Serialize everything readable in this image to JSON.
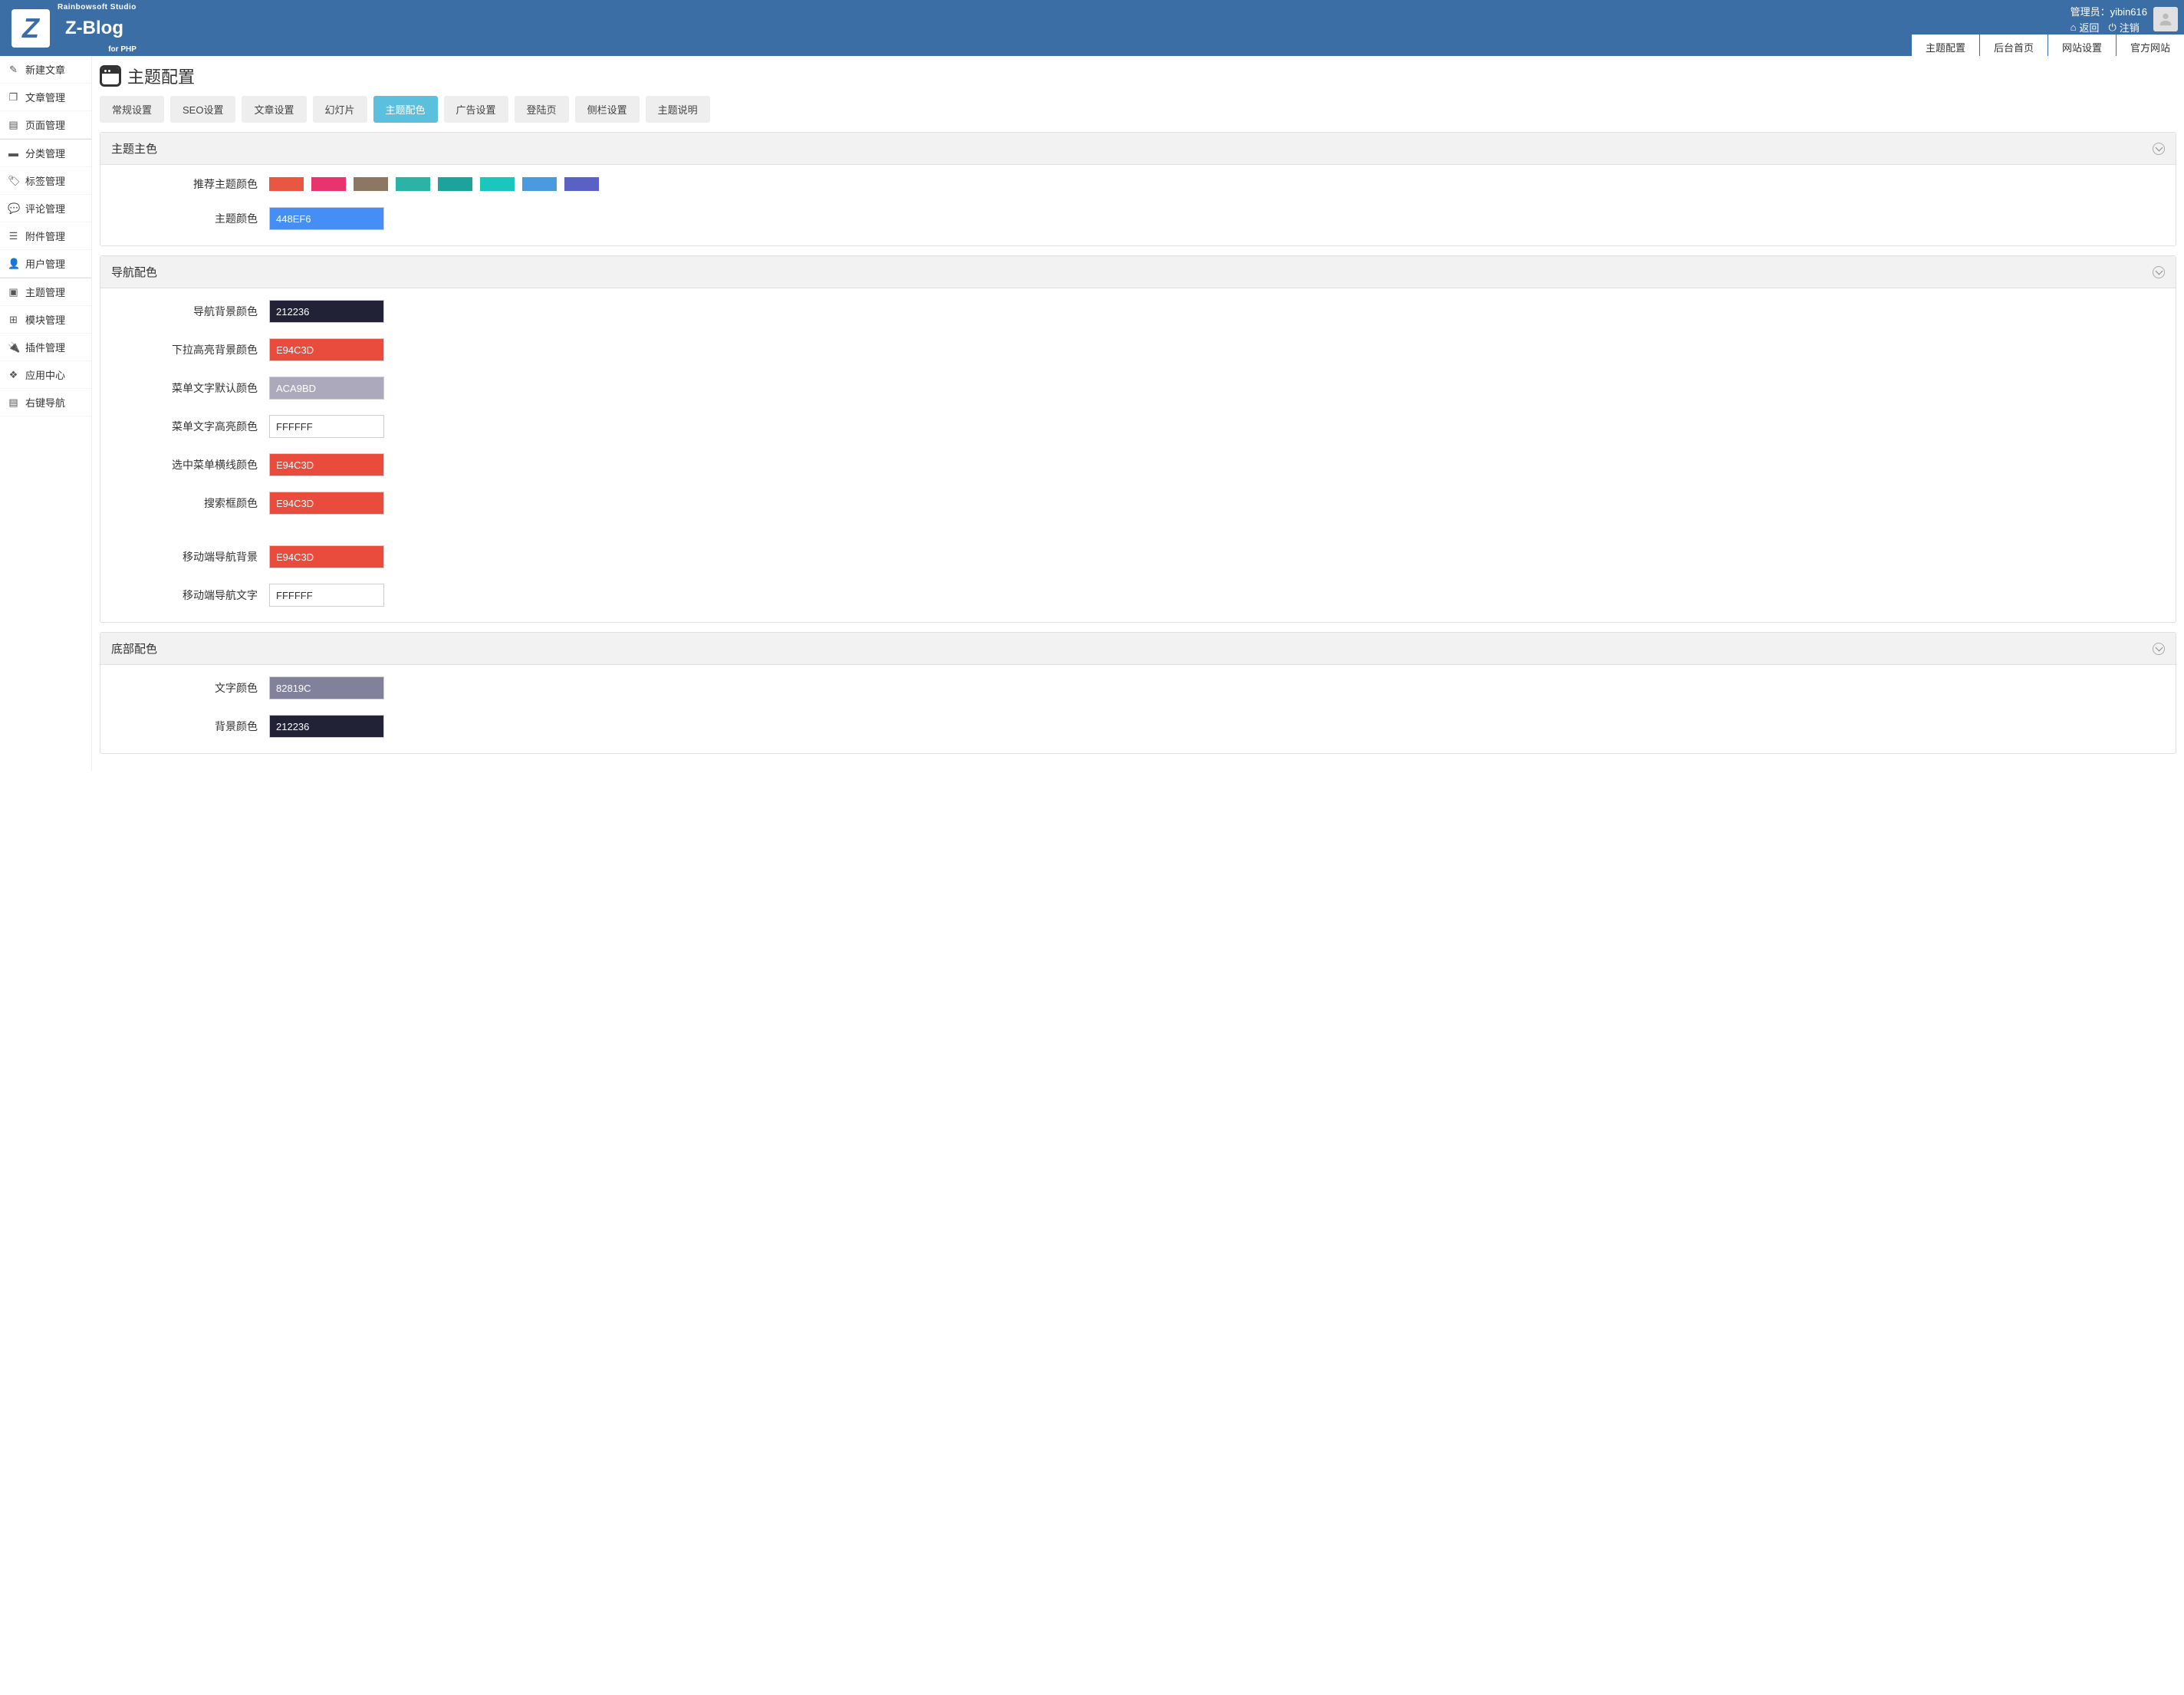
{
  "header": {
    "logo_sub": "Rainbowsoft Studio",
    "logo_main": "Z-Blog",
    "logo_php": "for PHP",
    "admin_label": "管理员：yibin616",
    "back_link": "返回",
    "logout_link": "注销",
    "top_tabs": [
      "主题配置",
      "后台首页",
      "网站设置",
      "官方网站"
    ]
  },
  "sidebar": {
    "items": [
      {
        "icon": "✎",
        "label": "新建文章"
      },
      {
        "icon": "❐",
        "label": "文章管理"
      },
      {
        "icon": "▤",
        "label": "页面管理"
      },
      {
        "icon": "▬",
        "label": "分类管理",
        "sep": true
      },
      {
        "icon": "🏷",
        "label": "标签管理"
      },
      {
        "icon": "💬",
        "label": "评论管理"
      },
      {
        "icon": "☰",
        "label": "附件管理"
      },
      {
        "icon": "👤",
        "label": "用户管理"
      },
      {
        "icon": "▣",
        "label": "主题管理",
        "sep": true
      },
      {
        "icon": "⊞",
        "label": "模块管理"
      },
      {
        "icon": "🔌",
        "label": "插件管理"
      },
      {
        "icon": "❖",
        "label": "应用中心"
      },
      {
        "icon": "▤",
        "label": "右键导航"
      }
    ]
  },
  "main": {
    "title": "主题配置",
    "sub_tabs": [
      "常规设置",
      "SEO设置",
      "文章设置",
      "幻灯片",
      "主题配色",
      "广告设置",
      "登陆页",
      "侧栏设置",
      "主题说明"
    ],
    "active_tab": 4
  },
  "panels": {
    "main_color": {
      "title": "主题主色",
      "rec_label": "推荐主题颜色",
      "swatches": [
        "#e75742",
        "#e8336d",
        "#8d7762",
        "#2bb4a5",
        "#1ba39c",
        "#1bc6bc",
        "#4a9ae0",
        "#5961c4"
      ],
      "theme_label": "主题颜色",
      "theme_value": "448EF6"
    },
    "nav": {
      "title": "导航配色",
      "fields": [
        {
          "label": "导航背景颜色",
          "value": "212236",
          "bg": "#212236"
        },
        {
          "label": "下拉高亮背景颜色",
          "value": "E94C3D",
          "bg": "#E94C3D"
        },
        {
          "label": "菜单文字默认颜色",
          "value": "ACA9BD",
          "bg": "#ACA9BD"
        },
        {
          "label": "菜单文字高亮颜色",
          "value": "FFFFFF",
          "bg": "#FFFFFF",
          "light": true
        },
        {
          "label": "选中菜单横线颜色",
          "value": "E94C3D",
          "bg": "#E94C3D"
        },
        {
          "label": "搜索框颜色",
          "value": "E94C3D",
          "bg": "#E94C3D"
        }
      ],
      "mobile_fields": [
        {
          "label": "移动端导航背景",
          "value": "E94C3D",
          "bg": "#E94C3D"
        },
        {
          "label": "移动端导航文字",
          "value": "FFFFFF",
          "bg": "#FFFFFF",
          "light": true
        }
      ]
    },
    "footer": {
      "title": "底部配色",
      "fields": [
        {
          "label": "文字颜色",
          "value": "82819C",
          "bg": "#82819C"
        },
        {
          "label": "背景颜色",
          "value": "212236",
          "bg": "#212236"
        }
      ]
    }
  }
}
